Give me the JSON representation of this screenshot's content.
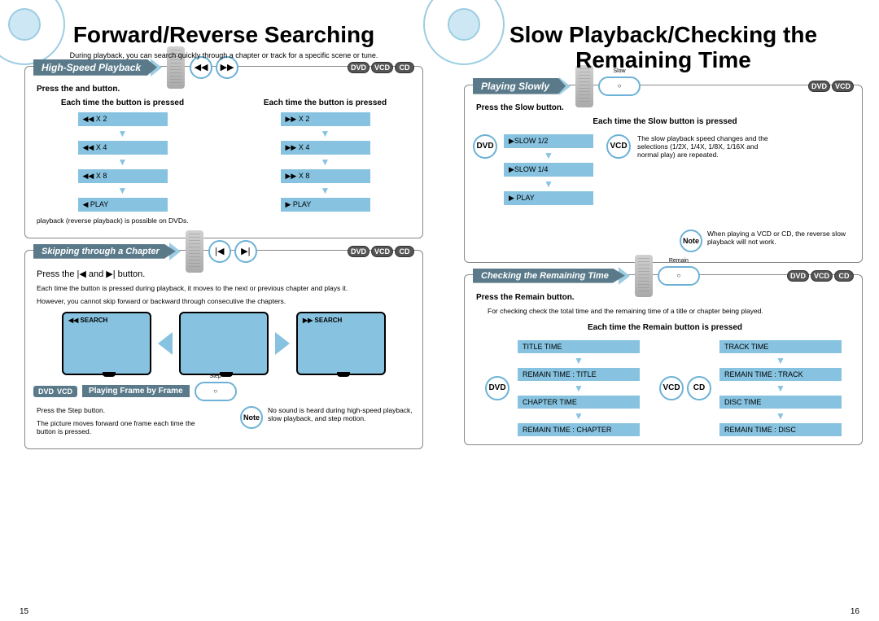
{
  "left": {
    "title": "Forward/Reverse Searching",
    "subtitle": "During playback, you can search quickly through a chapter or track for a specific scene or tune.",
    "page_num": "15",
    "highspeed": {
      "banner": "High-Speed Playback",
      "badges": [
        "DVD",
        "VCD",
        "CD"
      ],
      "instr": "Press the        and        button.",
      "col_rev_title": "Each time the        button is pressed",
      "col_fwd_title": "Each time the        button is pressed",
      "rev_steps": [
        "◀◀  X 2",
        "◀◀  X 4",
        "◀◀  X 8",
        "◀  PLAY"
      ],
      "fwd_steps": [
        "▶▶  X 2",
        "▶▶  X 4",
        "▶▶  X 8",
        "▶  PLAY"
      ],
      "foot": "playback (reverse playback) is possible on DVDs."
    },
    "skip": {
      "banner": "Skipping through a Chapter",
      "badges": [
        "DVD",
        "VCD",
        "CD"
      ],
      "instr": "Press the |◀   and   ▶| button.",
      "body1": "Each time the button is pressed during playback, it moves to the next or previous chapter and plays it.",
      "body2": "However, you cannot skip forward or backward through consecutive the chapters.",
      "tv_rev": "◀◀ SEARCH",
      "tv_fwd": "▶▶ SEARCH"
    },
    "frame": {
      "pill_badges": [
        "DVD",
        "VCD"
      ],
      "pill_title": "Playing Frame by Frame",
      "oval_label": "Step",
      "line1": "Press the Step button.",
      "line2": "The picture moves forward one frame each time the button is pressed.",
      "note": "No sound is heard during high-speed playback, slow playback, and step motion."
    }
  },
  "right": {
    "title": "Slow Playback/Checking the Remaining Time",
    "page_num": "16",
    "slow": {
      "banner": "Playing Slowly",
      "badges": [
        "DVD",
        "VCD"
      ],
      "oval_label": "Slow",
      "instr": "Press the Slow button.",
      "sub": "Each time the Slow button is pressed",
      "dvd_steps": [
        "▶SLOW 1/2",
        "▶SLOW 1/4",
        "▶ PLAY"
      ],
      "vcd_text": "The slow playback speed changes and the selections (1/2X, 1/4X, 1/8X, 1/16X and normal play) are repeated.",
      "note": "When playing a VCD or CD, the reverse slow playback will not work."
    },
    "remain": {
      "banner": "Checking the Remaining Time",
      "badges": [
        "DVD",
        "VCD",
        "CD"
      ],
      "oval_label": "Remain",
      "instr": "Press the Remain button.",
      "body": "For checking check the total time and the remaining time of a title or chapter being played.",
      "sub": "Each time the Remain button is pressed",
      "dvd_steps": [
        "TITLE TIME",
        "REMAIN TIME : TITLE",
        "CHAPTER TIME",
        "REMAIN TIME : CHAPTER"
      ],
      "vcd_steps": [
        "TRACK TIME",
        "REMAIN TIME : TRACK",
        "DISC TIME",
        "REMAIN TIME : DISC"
      ]
    }
  },
  "labels": {
    "note": "Note",
    "dvd": "DVD",
    "vcd": "VCD",
    "cd": "CD"
  }
}
